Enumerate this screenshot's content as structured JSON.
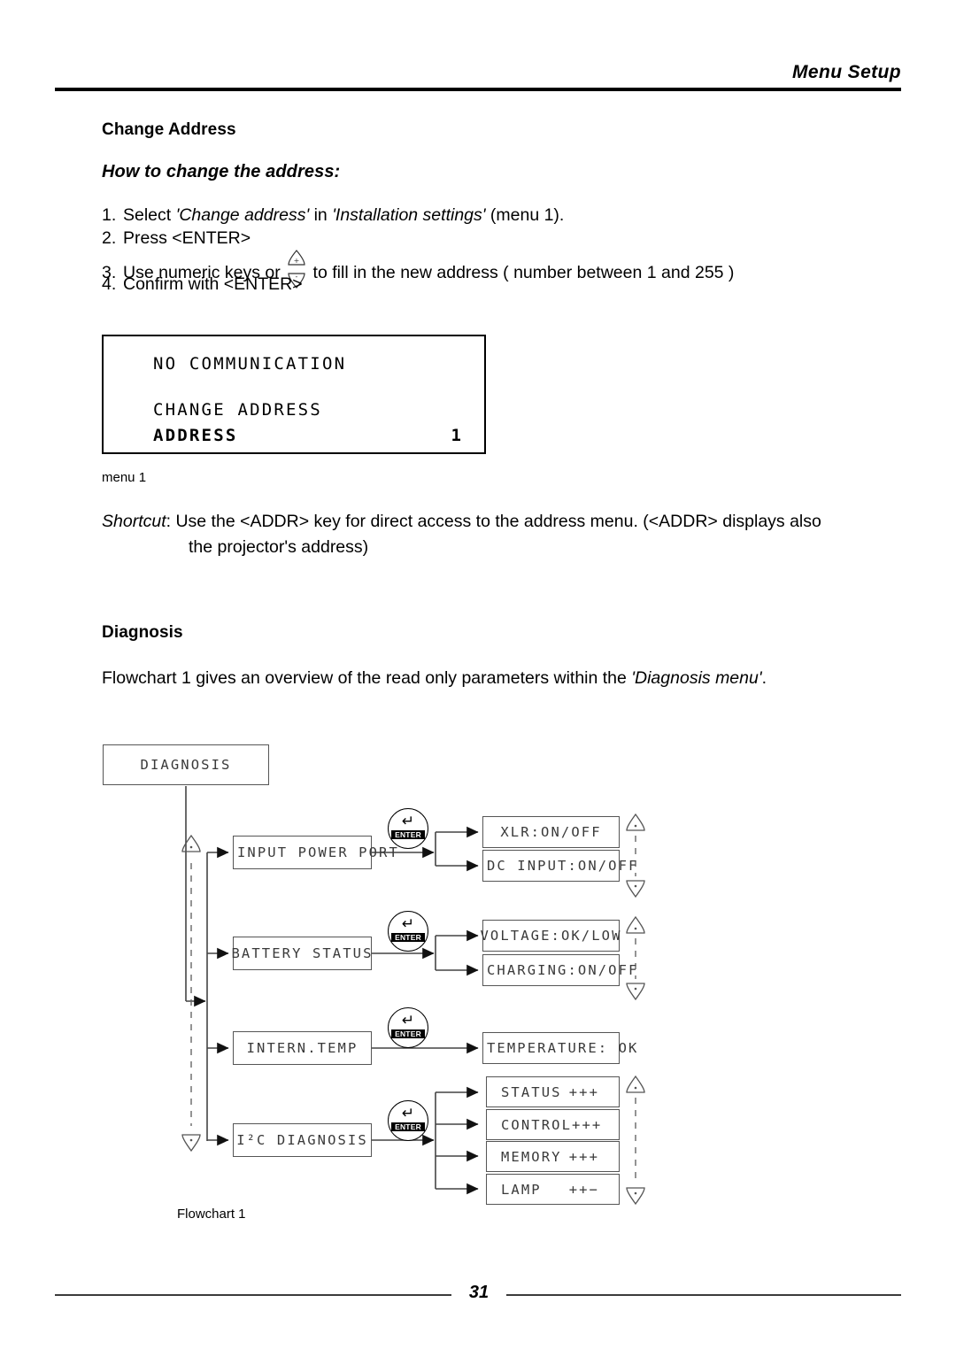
{
  "header": {
    "title": "Menu Setup"
  },
  "sections": {
    "change_address": {
      "heading": "Change Address",
      "subheading": "How to change the address:",
      "steps": [
        {
          "num": "1.",
          "before": "Select ",
          "italic1": "'Change address'",
          "mid": " in ",
          "italic2": "'Installation settings'",
          "after": " (menu 1)."
        },
        {
          "num": "2.",
          "before": "Press <ENTER>",
          "italic1": "",
          "mid": "",
          "italic2": "",
          "after": ""
        },
        {
          "num": "3.",
          "before": "Use numeric keys or ",
          "italic1": "",
          "mid": "",
          "italic2": "",
          "after": " to fill in the new address ( number between 1 and 255 )"
        },
        {
          "num": "4.",
          "before": "Confirm with <ENTER>",
          "italic1": "",
          "mid": "",
          "italic2": "",
          "after": ""
        }
      ],
      "lcd": {
        "line1": "NO COMMUNICATION",
        "line2": "CHANGE ADDRESS",
        "line3": "ADDRESS",
        "value": "1"
      },
      "lcd_caption": "menu 1",
      "shortcut": {
        "label": "Shortcut",
        "line1": ": Use the <ADDR> key for direct access to the address menu. (<ADDR>  displays also",
        "line2": "the projector's  address)"
      }
    },
    "diagnosis": {
      "heading": "Diagnosis",
      "intro_before": "Flowchart 1 gives an overview of the read only parameters within the ",
      "intro_italic": "'Diagnosis menu'",
      "intro_after": "."
    }
  },
  "flowchart": {
    "caption": "Flowchart 1",
    "root": "DIAGNOSIS",
    "enter_label": "ENTER",
    "enter_glyph": "↵",
    "branches": [
      {
        "name": "INPUT POWER PORT",
        "leaves": [
          {
            "label": "XLR:ON/OFF",
            "value": ""
          },
          {
            "label": "DC INPUT:ON/OFF",
            "value": ""
          }
        ]
      },
      {
        "name": "BATTERY STATUS",
        "leaves": [
          {
            "label": "VOLTAGE:OK/LOW",
            "value": ""
          },
          {
            "label": "CHARGING:ON/OFF",
            "value": ""
          }
        ]
      },
      {
        "name": "INTERN.TEMP",
        "leaves": [
          {
            "label": "TEMPERATURE: OK",
            "value": ""
          }
        ]
      },
      {
        "name": "I²C DIAGNOSIS",
        "leaves": [
          {
            "label": "STATUS",
            "value": "+++"
          },
          {
            "label": "CONTROL",
            "value": "+++"
          },
          {
            "label": "MEMORY",
            "value": "+++"
          },
          {
            "label": "LAMP",
            "value": "++−"
          }
        ]
      }
    ]
  },
  "footer": {
    "page_number": "31"
  }
}
